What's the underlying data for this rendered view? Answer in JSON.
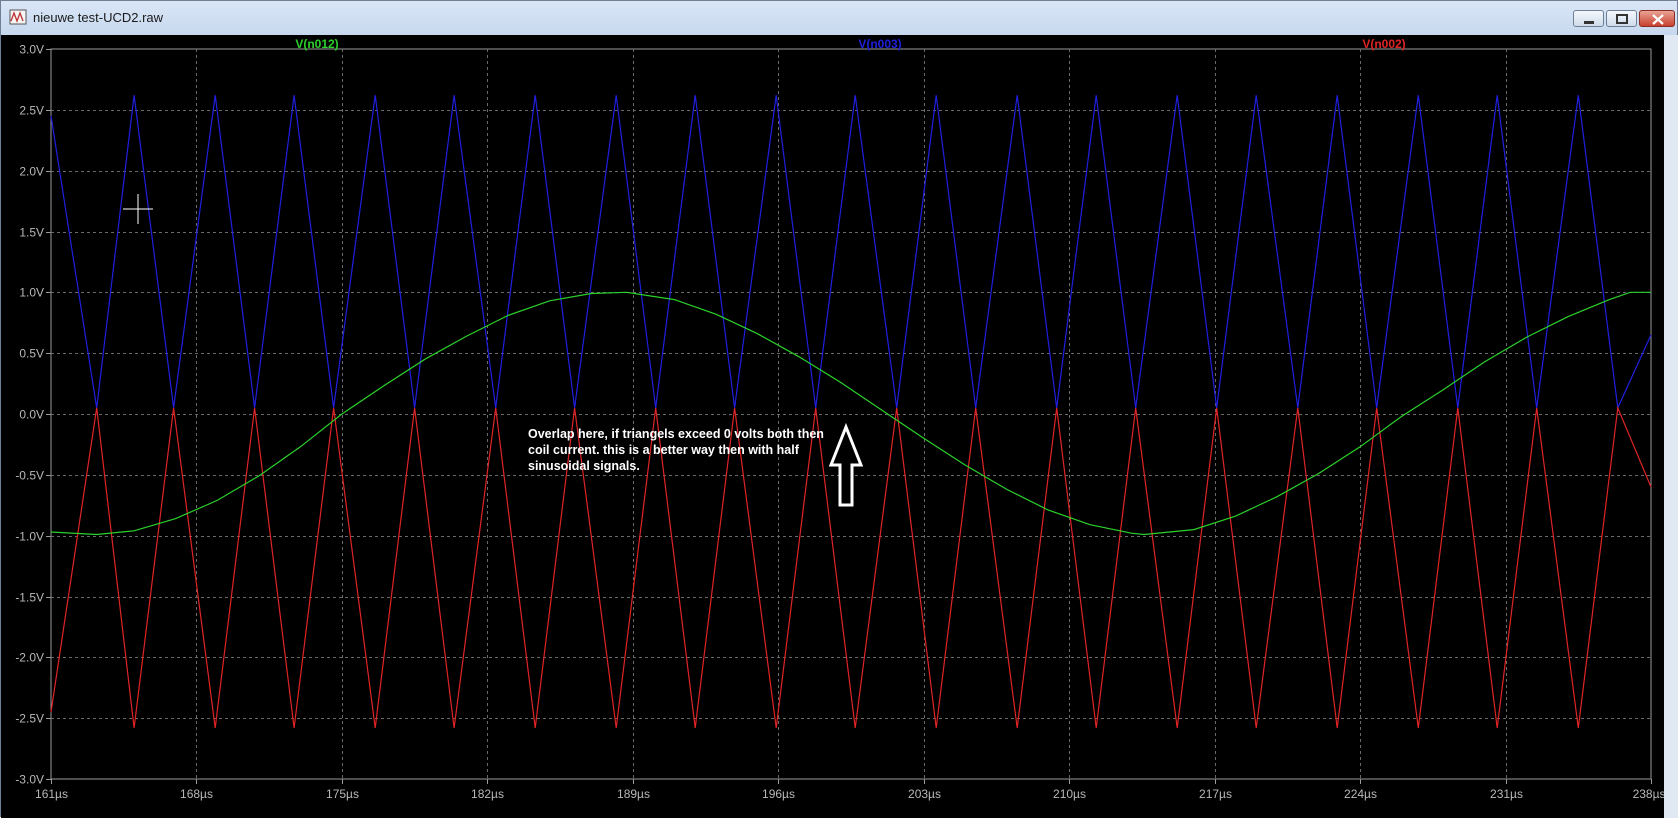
{
  "window": {
    "title": "nieuwe test-UCD2.raw",
    "buttons": [
      "minimize",
      "maximize",
      "close"
    ]
  },
  "legend": [
    {
      "label": "V(n012)",
      "color": "#2bd12b"
    },
    {
      "label": "V(n003)",
      "color": "#1f1fe0"
    },
    {
      "label": "V(n002)",
      "color": "#e02424"
    }
  ],
  "annotation": "Overlap here, if triangels exceed 0 volts both then coil current. this is a better way then with half sinusoidal signals.",
  "chart_data": {
    "type": "line",
    "x_unit": "µs",
    "y_unit": "V",
    "xlim": [
      161,
      238
    ],
    "ylim": [
      -3,
      3
    ],
    "x_ticks": [
      "161µs",
      "168µs",
      "175µs",
      "182µs",
      "189µs",
      "196µs",
      "203µs",
      "210µs",
      "217µs",
      "224µs",
      "231µs",
      "238µs"
    ],
    "y_ticks": [
      "3.0V",
      "2.5V",
      "2.0V",
      "1.5V",
      "1.0V",
      "0.5V",
      "0.0V",
      "-0.5V",
      "-1.0V",
      "-1.5V",
      "-2.0V",
      "-2.5V",
      "-3.0V"
    ],
    "grid": true,
    "series": [
      {
        "name": "V(n012)",
        "color": "#2bd12b",
        "x": [
          161,
          163.2,
          165,
          167,
          169,
          171,
          173,
          175,
          177,
          179,
          181,
          183,
          185,
          187,
          188.7,
          191,
          193,
          195,
          197,
          199,
          201,
          203,
          205,
          207,
          209,
          211,
          213,
          213.6,
          216,
          218,
          220,
          222,
          224,
          226,
          228,
          230,
          232,
          234,
          236,
          237,
          238
        ],
        "y": [
          -0.97,
          -0.99,
          -0.96,
          -0.86,
          -0.71,
          -0.51,
          -0.27,
          0.0,
          0.23,
          0.45,
          0.64,
          0.81,
          0.93,
          0.99,
          1.0,
          0.94,
          0.82,
          0.66,
          0.47,
          0.26,
          0.03,
          -0.2,
          -0.42,
          -0.62,
          -0.79,
          -0.91,
          -0.98,
          -0.99,
          -0.95,
          -0.84,
          -0.68,
          -0.49,
          -0.27,
          -0.02,
          0.2,
          0.43,
          0.63,
          0.8,
          0.94,
          1.0,
          1.0
        ]
      },
      {
        "name": "V(n003)",
        "color": "#1f1fe0",
        "x": [
          161.0,
          163.2,
          165.0,
          166.9,
          168.9,
          170.8,
          172.7,
          174.6,
          176.6,
          178.5,
          180.4,
          182.4,
          184.3,
          186.2,
          188.2,
          190.1,
          192.0,
          193.9,
          195.9,
          197.8,
          199.7,
          201.7,
          203.6,
          205.5,
          207.5,
          209.4,
          211.3,
          213.2,
          215.2,
          217.1,
          219.0,
          221.0,
          222.9,
          224.8,
          226.8,
          228.7,
          230.6,
          232.5,
          234.5,
          236.4,
          238.0
        ],
        "y": [
          2.45,
          0.05,
          2.62,
          0.05,
          2.62,
          0.05,
          2.62,
          0.05,
          2.62,
          0.05,
          2.62,
          0.05,
          2.62,
          0.05,
          2.62,
          0.05,
          2.62,
          0.05,
          2.62,
          0.05,
          2.62,
          0.05,
          2.62,
          0.05,
          2.62,
          0.05,
          2.62,
          0.05,
          2.62,
          0.05,
          2.62,
          0.05,
          2.62,
          0.05,
          2.62,
          0.05,
          2.62,
          0.05,
          2.62,
          0.05,
          0.65
        ]
      },
      {
        "name": "V(n002)",
        "color": "#e02424",
        "x": [
          161.0,
          163.2,
          165.0,
          166.9,
          168.9,
          170.8,
          172.7,
          174.6,
          176.6,
          178.5,
          180.4,
          182.4,
          184.3,
          186.2,
          188.2,
          190.1,
          192.0,
          193.9,
          195.9,
          197.8,
          199.7,
          201.7,
          203.6,
          205.5,
          207.5,
          209.4,
          211.3,
          213.2,
          215.2,
          217.1,
          219.0,
          221.0,
          222.9,
          224.8,
          226.8,
          228.7,
          230.6,
          232.5,
          234.5,
          236.4,
          238.0
        ],
        "y": [
          -2.45,
          0.05,
          -2.58,
          0.05,
          -2.58,
          0.05,
          -2.58,
          0.05,
          -2.58,
          0.05,
          -2.58,
          0.05,
          -2.58,
          0.05,
          -2.58,
          0.05,
          -2.58,
          0.05,
          -2.58,
          0.05,
          -2.58,
          0.05,
          -2.58,
          0.05,
          -2.58,
          0.05,
          -2.58,
          0.05,
          -2.58,
          0.05,
          -2.58,
          0.05,
          -2.58,
          0.05,
          -2.58,
          0.05,
          -2.58,
          0.05,
          -2.58,
          0.05,
          -0.6
        ]
      }
    ]
  }
}
